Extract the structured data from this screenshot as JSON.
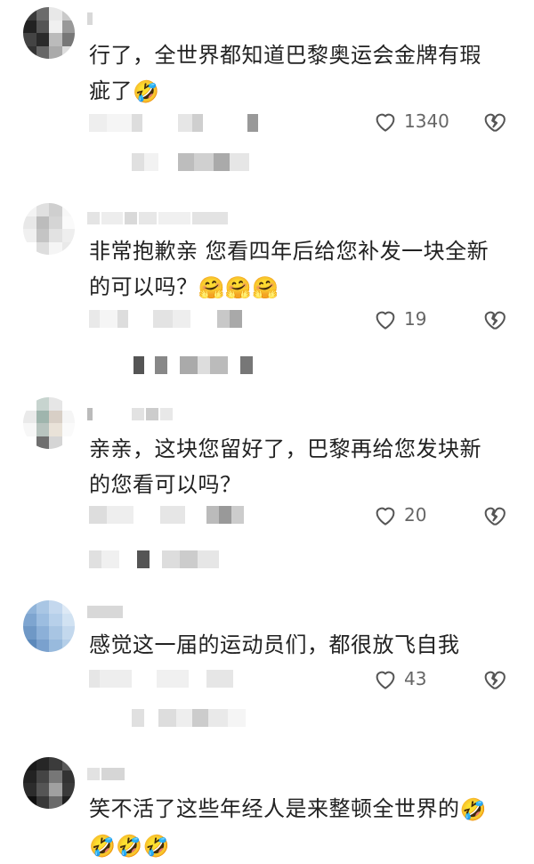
{
  "comments": [
    {
      "text_lines": [
        "行了，全世界都知道巴黎奥运会金牌有瑕",
        "疵了"
      ],
      "emoji": "🤣",
      "like_count": "1340",
      "icons": {
        "like": "heart-icon",
        "dislike": "broken-heart-icon"
      }
    },
    {
      "text_lines": [
        "非常抱歉亲 您看四年后给您补发一块全新",
        "的可以吗？"
      ],
      "emoji": "🤗🤗🤗",
      "like_count": "19",
      "icons": {
        "like": "heart-icon",
        "dislike": "broken-heart-icon"
      }
    },
    {
      "text_lines": [
        "亲亲，这块您留好了，巴黎再给您发块新",
        "的您看可以吗？"
      ],
      "emoji": "",
      "like_count": "20",
      "icons": {
        "like": "heart-icon",
        "dislike": "broken-heart-icon"
      }
    },
    {
      "text_lines": [
        "感觉这一届的运动员们，都很放飞自我"
      ],
      "emoji": "",
      "like_count": "43",
      "icons": {
        "like": "heart-icon",
        "dislike": "broken-heart-icon"
      }
    },
    {
      "text_lines": [
        "笑不活了这些年经人是来整顿全世界的"
      ],
      "emoji": "🤣",
      "emoji_line2": "🤣🤣🤣",
      "like_count": "",
      "icons": {
        "like": "heart-icon",
        "dislike": "broken-heart-icon"
      }
    }
  ],
  "colors": {
    "text": "#222222",
    "count": "#666666",
    "icon_stroke": "#555555",
    "background": "#ffffff"
  }
}
